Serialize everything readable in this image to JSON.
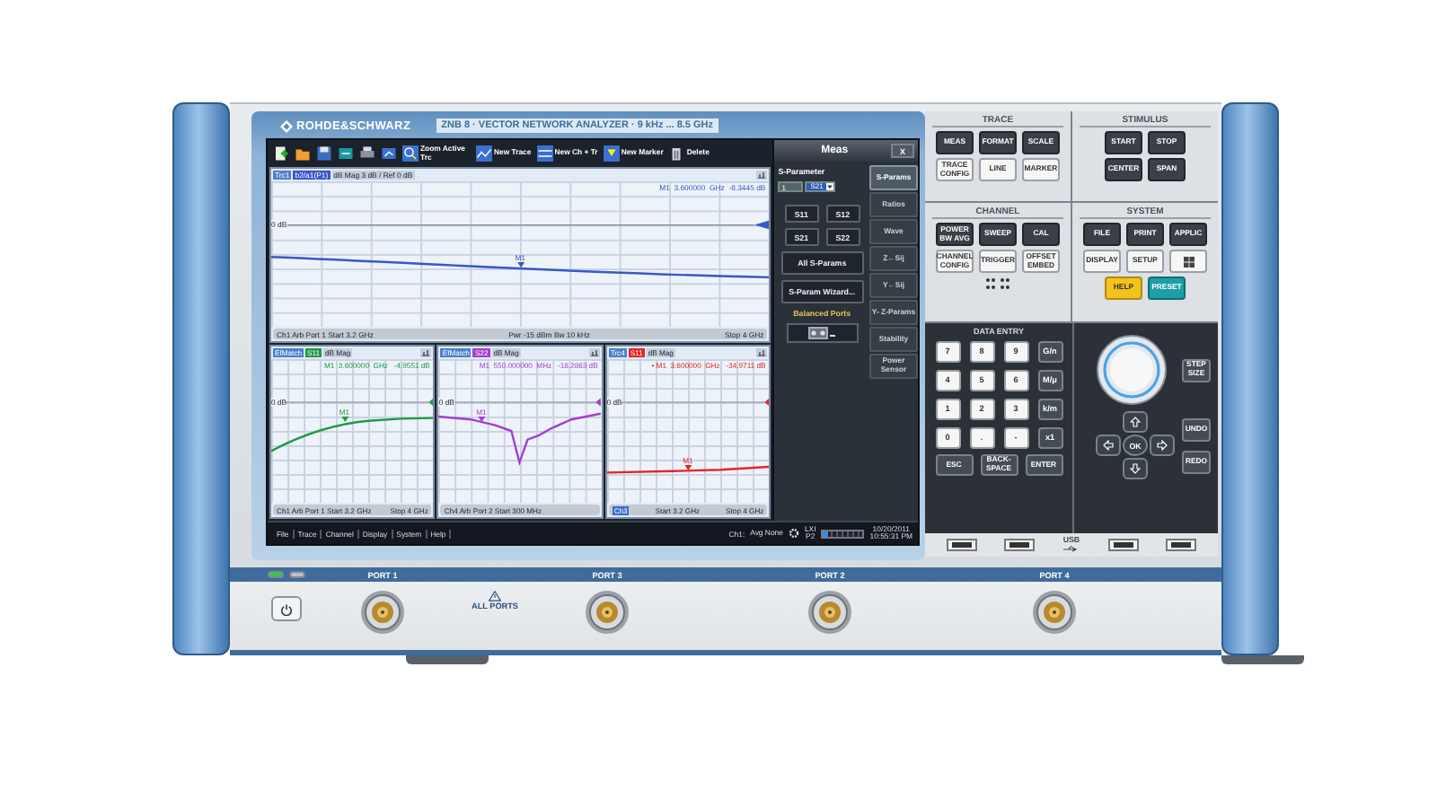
{
  "header": {
    "logo": "ROHDE&SCHWARZ",
    "title": "ZNB 8 · VECTOR NETWORK ANALYZER · 9 kHz ... 8.5 GHz"
  },
  "toolbar": [
    {
      "kind": "new"
    },
    {
      "kind": "open"
    },
    {
      "kind": "save"
    },
    {
      "kind": "recall"
    },
    {
      "kind": "print"
    },
    {
      "kind": "screenshot"
    },
    {
      "kind": "zoom",
      "label": "Zoom Active Trc"
    },
    {
      "kind": "trace",
      "label": "New Trace"
    },
    {
      "kind": "channel",
      "label": "New Ch + Tr"
    },
    {
      "kind": "marker",
      "label": "New Marker"
    },
    {
      "kind": "delete",
      "label": "Delete"
    }
  ],
  "diagrams": [
    {
      "trace": "Trc1",
      "parameter": "b2/a1(P1)",
      "format": "dB Mag 3 dB / Ref 0 dB",
      "readout": "M1  3.600000  GHz  -8.3445 dB",
      "ref": "0 dB",
      "marker": "M1",
      "color": "#3a56c8",
      "kind": "falling",
      "footer": [
        {
          "text": "Ch1  Arb Port 1  Start 3.2 GHz",
          "highlighted": false
        },
        {
          "text": "Pwr -15 dBm  Bw 10 kHz",
          "highlighted": false
        },
        {
          "text": "Stop 4 GHz",
          "highlighted": false
        }
      ]
    },
    {
      "trace": "EfMatch",
      "parameter": "S11",
      "format": "dB Mag",
      "readout": "M1  3.600000  GHz   -4.9551 dB",
      "ref": "0 dB",
      "marker": "M1",
      "color": "#1e9a48",
      "kind": "rising",
      "footer": [
        {
          "text": "Ch1  Arb Port 1  Start 3.2 GHz",
          "highlighted": false
        },
        {
          "text": "Stop 4 GHz",
          "highlighted": false
        }
      ]
    },
    {
      "trace": "EfMatch",
      "parameter": "S22",
      "format": "dB Mag",
      "readout": "M1  550.000000  MHz   -18.2863 dB",
      "ref": "0 dB",
      "marker": "M1",
      "color": "#a33fd0",
      "kind": "notch",
      "footer": [
        {
          "text": "Ch4  Arb Port 2  Start 300 MHz",
          "highlighted": false
        }
      ]
    },
    {
      "trace": "Trc4",
      "parameter": "S11",
      "format": "dB Mag",
      "readout": "• M1  3.600000  GHz   -34.9711 dB",
      "ref": "0 dB",
      "marker": "M1",
      "color": "#e5252b",
      "kind": "flat",
      "footer": [
        {
          "text": "Ch3",
          "highlighted": true
        },
        {
          "text": "Start 3.2 GHz",
          "highlighted": false
        },
        {
          "text": "Stop 4 GHz",
          "highlighted": false
        }
      ]
    }
  ],
  "softkeys": {
    "title": "Meas",
    "close": "X",
    "group": "S-Parameter",
    "spin": "1",
    "combo": "S21",
    "buttons": [
      "S11",
      "S12",
      "S21",
      "S22"
    ],
    "all": "All S-Params",
    "wizard": "S-Param Wizard...",
    "balanced": "Balanced Ports",
    "side_tabs": [
      {
        "label": "S-Params",
        "selected": true
      },
      {
        "label": "Ratios",
        "selected": false
      },
      {
        "label": "Wave",
        "selected": false
      },
      {
        "label": "Z←Sij",
        "selected": false
      },
      {
        "label": "Y←Sij",
        "selected": false
      },
      {
        "label": "Y- Z-Params",
        "selected": false
      },
      {
        "label": "Stability",
        "selected": false
      },
      {
        "label": "Power Sensor",
        "selected": false
      }
    ]
  },
  "menu": [
    "File",
    "Trace",
    "Channel",
    "Display",
    "System",
    "Help"
  ],
  "status": {
    "channel": "Ch1:",
    "avg": "Avg None",
    "lxi": "LXI",
    "port": "P2",
    "date": "10/20/2011",
    "time": "10:55:31 PM"
  },
  "front_panel": {
    "sections": [
      {
        "title": "TRACE",
        "rows": [
          [
            {
              "label": "MEAS",
              "kind": "dark"
            },
            {
              "label": "FORMAT",
              "kind": "dark"
            },
            {
              "label": "SCALE",
              "kind": "dark"
            }
          ],
          [
            {
              "label": "TRACE CONFIG",
              "kind": "light"
            },
            {
              "label": "LINE",
              "kind": "light"
            },
            {
              "label": "MARKER",
              "kind": "light"
            }
          ]
        ]
      },
      {
        "title": "STIMULUS",
        "rows": [
          [
            {
              "label": "START",
              "kind": "dark"
            },
            {
              "label": "STOP",
              "kind": "dark"
            }
          ],
          [
            {
              "label": "CENTER",
              "kind": "dark"
            },
            {
              "label": "SPAN",
              "kind": "dark"
            }
          ]
        ]
      },
      {
        "title": "CHANNEL",
        "rows": [
          [
            {
              "label": "POWER BW AVG",
              "kind": "dark"
            },
            {
              "label": "SWEEP",
              "kind": "dark"
            },
            {
              "label": "CAL",
              "kind": "dark"
            }
          ],
          [
            {
              "label": "CHANNEL CONFIG",
              "kind": "light"
            },
            {
              "label": "TRIGGER",
              "kind": "light"
            },
            {
              "label": "OFFSET EMBED",
              "kind": "light"
            }
          ]
        ]
      },
      {
        "title": "SYSTEM",
        "rows": [
          [
            {
              "label": "FILE",
              "kind": "dark"
            },
            {
              "label": "PRINT",
              "kind": "dark"
            },
            {
              "label": "APPLIC",
              "kind": "dark"
            }
          ],
          [
            {
              "label": "DISPLAY",
              "kind": "light"
            },
            {
              "label": "SETUP",
              "kind": "light"
            },
            {
              "kind": "windows"
            }
          ],
          [
            {
              "label": "HELP",
              "kind": "help"
            },
            {
              "label": "PRESET",
              "kind": "preset"
            }
          ]
        ]
      }
    ],
    "data_entry": {
      "title": "DATA ENTRY",
      "rows": [
        [
          {
            "label": "7",
            "kind": "light"
          },
          {
            "label": "8",
            "kind": "light"
          },
          {
            "label": "9",
            "kind": "light"
          },
          {
            "label": "G/n",
            "kind": "dark"
          }
        ],
        [
          {
            "label": "4",
            "kind": "light"
          },
          {
            "label": "5",
            "kind": "light"
          },
          {
            "label": "6",
            "kind": "light"
          },
          {
            "label": "M/μ",
            "kind": "dark"
          }
        ],
        [
          {
            "label": "1",
            "kind": "light"
          },
          {
            "label": "2",
            "kind": "light"
          },
          {
            "label": "3",
            "kind": "light"
          },
          {
            "label": "k/m",
            "kind": "dark"
          }
        ],
        [
          {
            "label": "0",
            "kind": "light"
          },
          {
            "label": ".",
            "kind": "light"
          },
          {
            "label": "-",
            "kind": "light"
          },
          {
            "label": "x1",
            "kind": "dark"
          }
        ]
      ],
      "actions": [
        {
          "label": "ESC",
          "kind": "dark"
        },
        {
          "label": "BACK-SPACE",
          "kind": "dark"
        },
        {
          "label": "ENTER",
          "kind": "dark"
        }
      ],
      "step_size": "STEP SIZE",
      "ok": "OK",
      "undo": "UNDO",
      "redo": "REDO"
    },
    "usb_label": "USB"
  },
  "ports": {
    "leds": [
      {
        "on": true
      },
      {
        "on": false
      }
    ],
    "labels": [
      "PORT 1",
      "PORT 3",
      "PORT 2",
      "PORT 4"
    ],
    "warning": "ALL PORTS"
  }
}
